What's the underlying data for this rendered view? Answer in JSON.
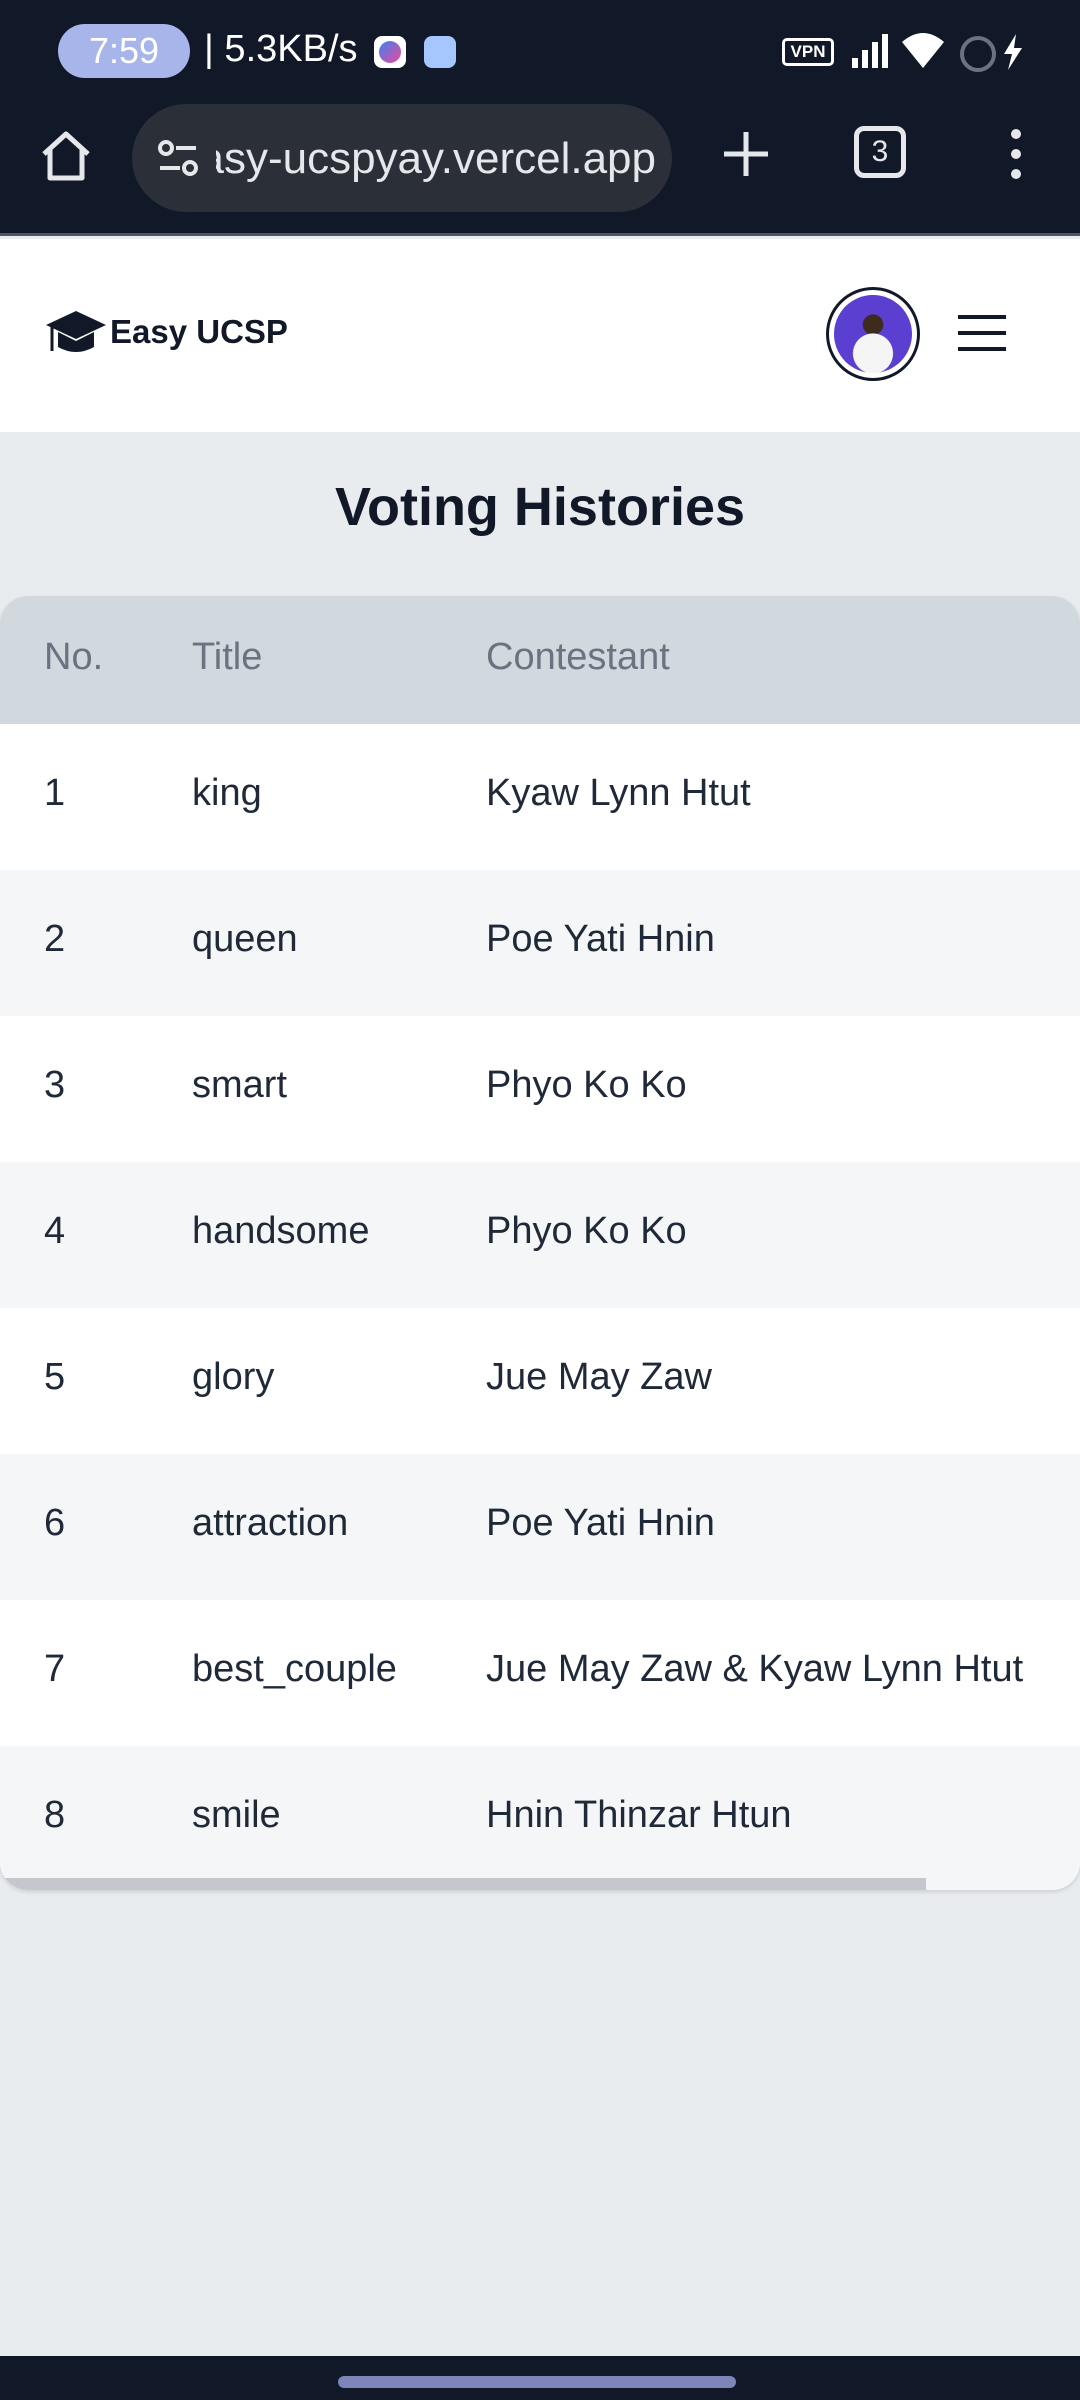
{
  "status_bar": {
    "time": "7:59",
    "net_speed": "| 5.3KB/s",
    "vpn_label": "VPN"
  },
  "browser": {
    "url": "easy-ucspyay.vercel.app",
    "tab_count": "3"
  },
  "header": {
    "logo_text": "Easy UCSP"
  },
  "page": {
    "title": "Voting Histories"
  },
  "table": {
    "columns": [
      "No.",
      "Title",
      "Contestant"
    ],
    "rows": [
      {
        "no": "1",
        "title": "king",
        "contestant": "Kyaw Lynn Htut"
      },
      {
        "no": "2",
        "title": "queen",
        "contestant": "Poe Yati Hnin"
      },
      {
        "no": "3",
        "title": "smart",
        "contestant": "Phyo Ko Ko"
      },
      {
        "no": "4",
        "title": "handsome",
        "contestant": "Phyo Ko Ko"
      },
      {
        "no": "5",
        "title": "glory",
        "contestant": "Jue May Zaw"
      },
      {
        "no": "6",
        "title": "attraction",
        "contestant": "Poe Yati Hnin"
      },
      {
        "no": "7",
        "title": "best_couple",
        "contestant": "Jue May Zaw & Kyaw Lynn Htut"
      },
      {
        "no": "8",
        "title": "smile",
        "contestant": "Hnin Thinzar Htun"
      }
    ]
  },
  "icons": {
    "home": "home-icon",
    "site_settings": "tune-icon",
    "new_tab": "plus-icon",
    "menu": "more-vert-icon",
    "logo": "graduation-cap-icon",
    "hamburger": "menu-icon"
  },
  "colors": {
    "status_bg": "#111827",
    "header_bg": "#ffffff",
    "page_bg": "#e9ecef",
    "table_head_bg": "#d1d8de",
    "row_alt_bg": "#f4f6f8",
    "avatar_bg": "#5b3fd0"
  }
}
